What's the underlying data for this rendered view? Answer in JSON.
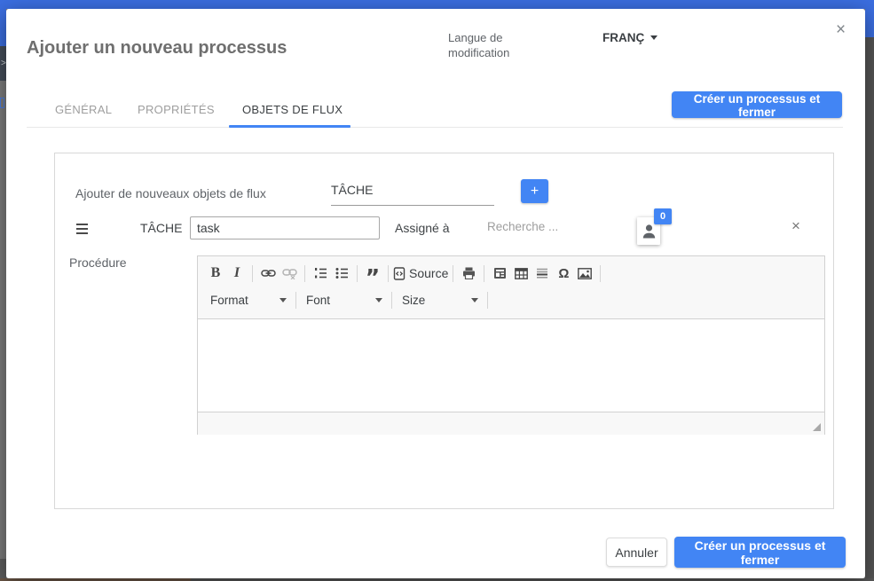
{
  "colors": {
    "accent": "#4285f4",
    "top_bar_blue": "#3b6ee0"
  },
  "background": {
    "chevron_glyph": ">"
  },
  "header": {
    "title": "Ajouter un nouveau processus",
    "language_label": "Langue de modification",
    "language_value": "FRANÇ",
    "close_glyph": "×"
  },
  "tabs": [
    {
      "label": "GÉNÉRAL",
      "active": false
    },
    {
      "label": "PROPRIÉTÉS",
      "active": false
    },
    {
      "label": "OBJETS DE FLUX",
      "active": true
    }
  ],
  "actions": {
    "create_top": "Créer un processus et fermer",
    "cancel": "Annuler",
    "create_bottom": "Créer un processus et fermer"
  },
  "flow_objects": {
    "add_label": "Ajouter de nouveaux objets de flux",
    "type_select_value": "TÂCHE",
    "add_button_glyph": "+",
    "task": {
      "type_label": "TÂCHE",
      "name_value": "task",
      "assigned_label": "Assigné à",
      "search_placeholder": "Recherche ...",
      "assignee_count": "0",
      "remove_glyph": "×"
    },
    "procedure_label": "Procédure"
  },
  "editor": {
    "icons": {
      "bold_glyph": "B",
      "italic_glyph": "I",
      "quote_glyph": "”",
      "omega_glyph": "Ω"
    },
    "source_label": "Source",
    "format_label": "Format",
    "font_label": "Font",
    "size_label": "Size"
  }
}
